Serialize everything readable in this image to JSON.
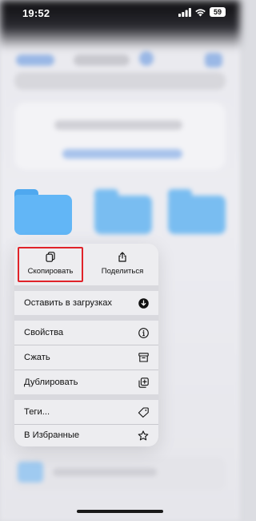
{
  "status_bar": {
    "time": "19:52",
    "battery": "59"
  },
  "context_menu": {
    "top_actions": [
      {
        "label": "Скопировать",
        "icon": "copy-icon",
        "highlighted": true
      },
      {
        "label": "Поделиться",
        "icon": "share-icon"
      }
    ],
    "items": [
      {
        "label": "Оставить в загрузках",
        "icon": "download-circle-icon"
      },
      {
        "label": "Свойства",
        "icon": "info-icon"
      },
      {
        "label": "Сжать",
        "icon": "archive-icon"
      },
      {
        "label": "Дублировать",
        "icon": "duplicate-icon"
      },
      {
        "label": "Теги...",
        "icon": "tag-icon"
      },
      {
        "label": "В Избранные",
        "icon": "star-icon"
      }
    ]
  },
  "colors": {
    "folder": "#62b6f6",
    "highlight_border": "#e0232a"
  }
}
